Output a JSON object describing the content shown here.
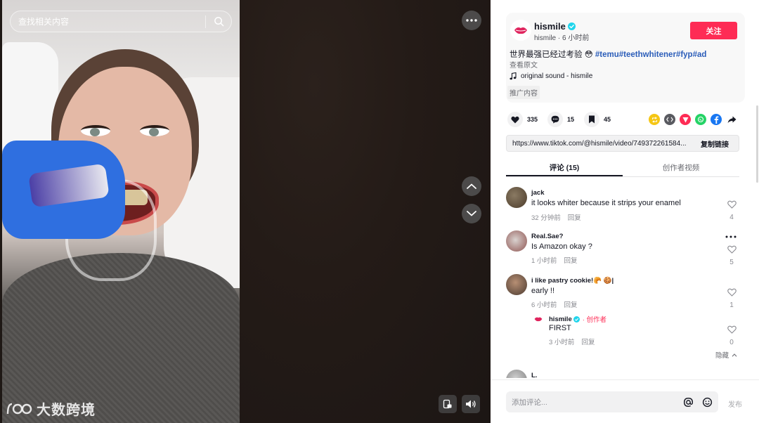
{
  "search": {
    "placeholder": "查找相关内容"
  },
  "video": {
    "watermark": "大数跨境"
  },
  "author": {
    "name": "hismile",
    "handle": "hismile",
    "time": "6 小时前",
    "follow_label": "关注"
  },
  "description": {
    "text": "世界最强已经过考验 😳",
    "hashtags": "#temu#teethwhitener#fyp#ad",
    "see_original": "查看原文",
    "music": "original sound - hismile",
    "promo_label": "推广内容"
  },
  "stats": {
    "likes": "335",
    "comments": "15",
    "saves": "45"
  },
  "share_icons": [
    "repost-icon",
    "embed-icon",
    "send-icon",
    "whatsapp-icon",
    "facebook-icon",
    "share-arrow-icon"
  ],
  "link": {
    "url": "https://www.tiktok.com/@hismile/video/749372261584...",
    "copy_label": "复制链接"
  },
  "tabs": [
    {
      "label": "评论 (15)",
      "active": true
    },
    {
      "label": "创作者视频",
      "active": false
    }
  ],
  "comments": [
    {
      "name": "jack",
      "text": "it looks whiter because it strips your enamel",
      "time": "32 分钟前",
      "reply": "回复",
      "likes": "4"
    },
    {
      "name": "Real.Sae?",
      "text": "Is Amazon okay ?",
      "time": "1 小时前",
      "reply": "回复",
      "likes": "5"
    },
    {
      "name": "i like pastry cookie!🥐 🍪|",
      "text": "early !!",
      "time": "6 小时前",
      "reply": "回复",
      "likes": "1"
    },
    {
      "name": "L.",
      "text": "",
      "time": "",
      "reply": "",
      "likes": ""
    }
  ],
  "reply": {
    "name": "hismile",
    "badge": "· 创作者",
    "text": "FIRST",
    "time": "3 小时前",
    "reply": "回复",
    "likes": "0"
  },
  "hide_label": "隐藏",
  "input": {
    "placeholder": "添加评论...",
    "post_label": "发布"
  },
  "colors": {
    "accent": "#fe2c55",
    "hashtag": "#2b5db9",
    "verified": "#20d5ec"
  }
}
